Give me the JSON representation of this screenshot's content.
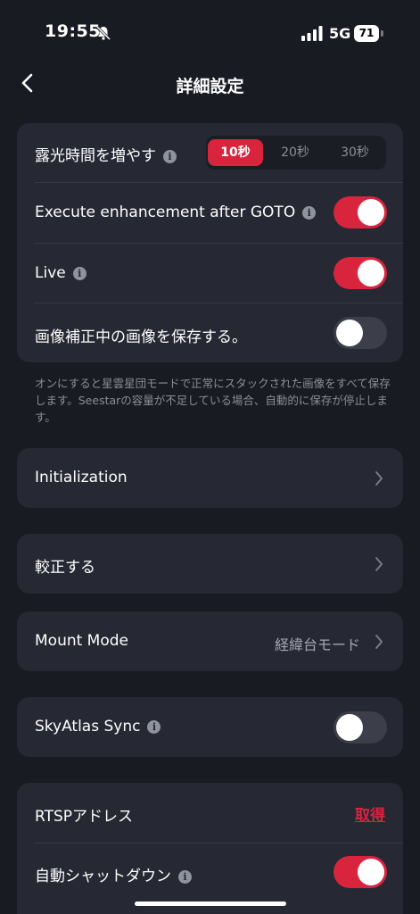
{
  "status": {
    "time": "19:55",
    "network": "5G",
    "battery": "71"
  },
  "nav": {
    "title": "詳細設定"
  },
  "card1": {
    "exposure": {
      "label": "露光時間を増やす",
      "options": [
        "10秒",
        "20秒",
        "30秒"
      ],
      "selected": "10秒"
    },
    "enhance": {
      "label": "Execute enhancement after GOTO",
      "on": true
    },
    "live": {
      "label": "Live",
      "on": true
    },
    "save_images": {
      "label": "画像補正中の画像を保存する。",
      "on": false
    }
  },
  "note": "オンにすると星雲星団モードで正常にスタックされた画像をすべて保存します。Seestarの容量が不足している場合、自動的に保存が停止します。",
  "initialization": {
    "label": "Initialization"
  },
  "calibrate": {
    "label": "較正する"
  },
  "mount": {
    "label": "Mount Mode",
    "value": "経緯台モード"
  },
  "skyatlas": {
    "label": "SkyAtlas Sync",
    "on": false
  },
  "rtsp": {
    "label": "RTSPアドレス",
    "action": "取得"
  },
  "shutdown": {
    "label": "自動シャットダウン",
    "on": true
  },
  "colors": {
    "accent": "#d8243d",
    "background": "#191b22",
    "card": "#262933"
  },
  "icons": [
    "bell-slash-icon",
    "signal-icon",
    "battery-icon",
    "back-chevron-icon",
    "info-icon",
    "chevron-right-icon"
  ]
}
